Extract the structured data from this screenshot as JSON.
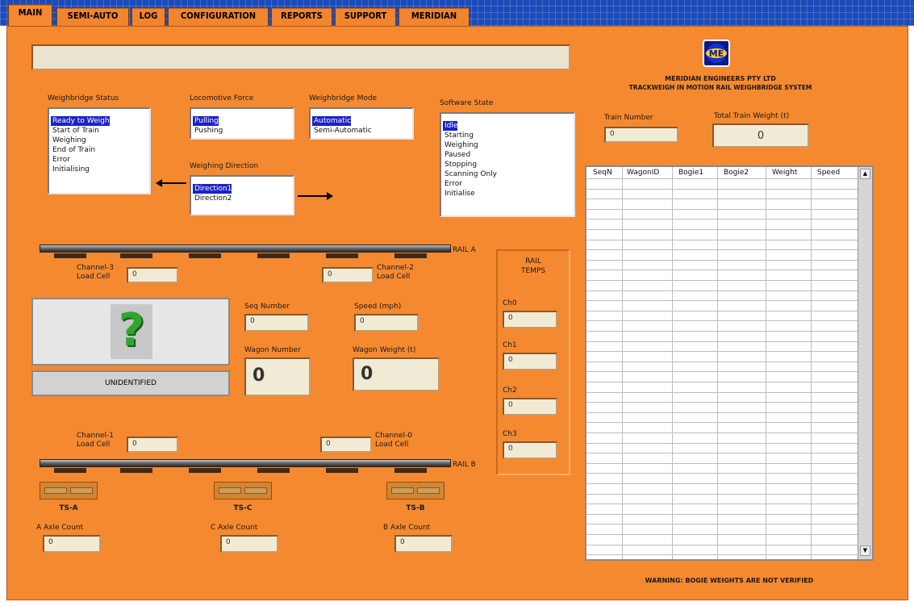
{
  "tabs": [
    {
      "label": "MAIN",
      "active": true
    },
    {
      "label": "SEMI-AUTO"
    },
    {
      "label": "LOG"
    },
    {
      "label": "CONFIGURATION"
    },
    {
      "label": "REPORTS"
    },
    {
      "label": "SUPPORT"
    },
    {
      "label": "MERIDIAN"
    }
  ],
  "company": {
    "name": "MERIDIAN ENGINEERS PTY LTD",
    "product": "TRACKWEIGH IN MOTION RAIL WEIGHBRIDGE SYSTEM",
    "logo_text": "ME"
  },
  "status_bar": {
    "value": ""
  },
  "weighbridge_status": {
    "label": "Weighbridge Status",
    "items": [
      "Ready to Weigh",
      "Start of Train",
      "Weighing",
      "End of Train",
      "Error",
      "Initialising"
    ],
    "selected": "Ready to Weigh"
  },
  "locomotive_force": {
    "label": "Locomotive Force",
    "items": [
      "Pulling",
      "Pushing"
    ],
    "selected": "Pulling"
  },
  "weighbridge_mode": {
    "label": "Weighbridge Mode",
    "items": [
      "Automatic",
      "Semi-Automatic"
    ],
    "selected": "Automatic"
  },
  "software_state": {
    "label": "Software State",
    "items": [
      "Idle",
      "Starting",
      "Weighing",
      "Paused",
      "Stopping",
      "Scanning Only",
      "Error",
      "Initialise"
    ],
    "selected": "Idle"
  },
  "weighing_direction": {
    "label": "Weighing Direction",
    "items": [
      "Direction1",
      "Direction2"
    ],
    "selected": "Direction1"
  },
  "train_number": {
    "label": "Train Number",
    "value": "0"
  },
  "total_train_weight": {
    "label": "Total Train Weight (t)",
    "value": "0"
  },
  "table": {
    "columns": [
      "SeqN",
      "WagonID",
      "Bogie1",
      "Bogie2",
      "Weight",
      "Speed"
    ]
  },
  "rail_a": {
    "label": "RAIL A"
  },
  "rail_b": {
    "label": "RAIL B"
  },
  "channel_3": {
    "label_line1": "Channel-3",
    "label_line2": "Load Cell",
    "value": "0"
  },
  "channel_2": {
    "label_line1": "Channel-2",
    "label_line2": "Load Cell",
    "value": "0"
  },
  "channel_1": {
    "label_line1": "Channel-1",
    "label_line2": "Load Cell",
    "value": "0"
  },
  "channel_0": {
    "label_line1": "Channel-0",
    "label_line2": "Load Cell",
    "value": "0"
  },
  "wagon_id_status": "UNIDENTIFIED",
  "seq_number": {
    "label": "Seq Number",
    "value": "0"
  },
  "speed": {
    "label": "Speed (mph)",
    "value": "0"
  },
  "wagon_number": {
    "label": "Wagon Number",
    "value": "0"
  },
  "wagon_weight": {
    "label": "Wagon Weight (t)",
    "value": "0"
  },
  "rail_temps": {
    "title_line1": "RAIL",
    "title_line2": "TEMPS",
    "channels": [
      {
        "label": "Ch0",
        "value": "0"
      },
      {
        "label": "Ch1",
        "value": "0"
      },
      {
        "label": "Ch2",
        "value": "0"
      },
      {
        "label": "Ch3",
        "value": "0"
      }
    ]
  },
  "track_switches": [
    {
      "label": "TS-A"
    },
    {
      "label": "TS-C"
    },
    {
      "label": "TS-B"
    }
  ],
  "axle_counts": [
    {
      "label": "A Axle Count",
      "value": "0"
    },
    {
      "label": "C Axle Count",
      "value": "0"
    },
    {
      "label": "B Axle Count",
      "value": "0"
    }
  ],
  "warning": "WARNING: BOGIE WEIGHTS ARE NOT VERIFIED",
  "colors": {
    "panel": "#f5892f",
    "tabbar": "#1b4bb8",
    "selection": "#1a22c8"
  }
}
